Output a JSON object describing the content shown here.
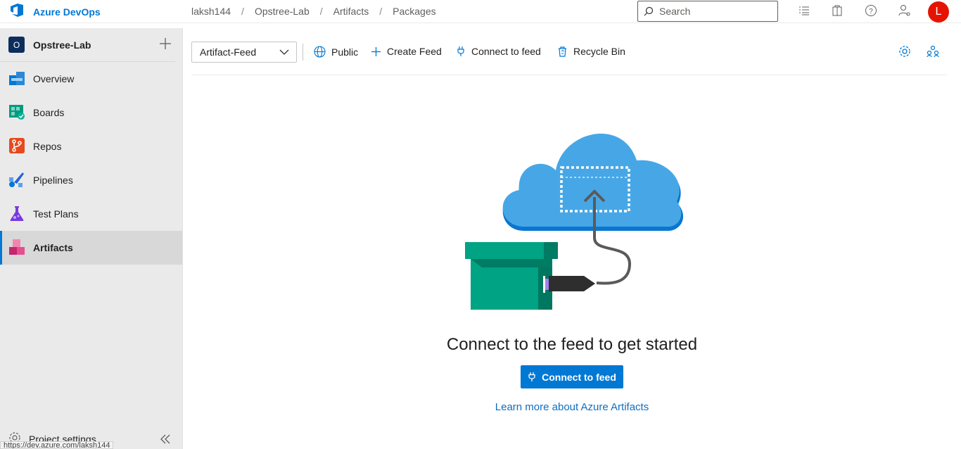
{
  "app": {
    "brand": "Azure DevOps"
  },
  "breadcrumb": [
    "laksh144",
    "Opstree-Lab",
    "Artifacts",
    "Packages"
  ],
  "search": {
    "placeholder": "Search"
  },
  "user": {
    "initial": "L",
    "color": "#e51400"
  },
  "sidebar": {
    "project": {
      "initial": "O",
      "name": "Opstree-Lab"
    },
    "items": [
      {
        "label": "Overview",
        "icon": "overview-icon"
      },
      {
        "label": "Boards",
        "icon": "boards-icon"
      },
      {
        "label": "Repos",
        "icon": "repos-icon"
      },
      {
        "label": "Pipelines",
        "icon": "pipelines-icon"
      },
      {
        "label": "Test Plans",
        "icon": "test-plans-icon"
      },
      {
        "label": "Artifacts",
        "icon": "artifacts-icon",
        "active": true
      }
    ],
    "settings_label": "Project settings"
  },
  "status_url": "https://dev.azure.com/laksh144",
  "toolbar": {
    "feed": "Artifact-Feed",
    "public_label": "Public",
    "create_label": "Create Feed",
    "connect_label": "Connect to feed",
    "recycle_label": "Recycle Bin"
  },
  "main": {
    "headline": "Connect to the feed to get started",
    "cta_label": "Connect to feed",
    "learn_link": "Learn more about Azure Artifacts"
  },
  "colors": {
    "accent": "#0078d4",
    "cloud": "#47a7e6",
    "box": "#00a383"
  }
}
